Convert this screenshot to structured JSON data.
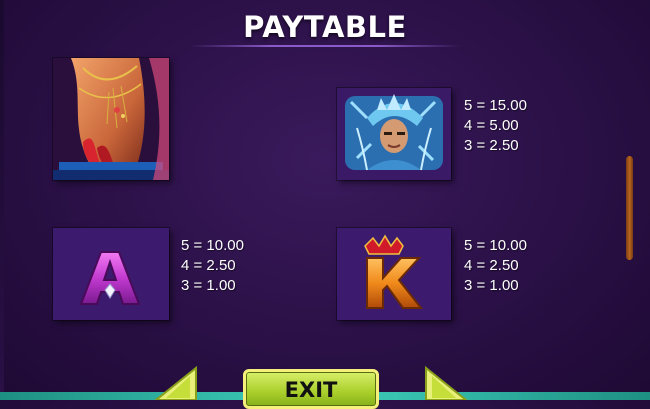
{
  "title": "PAYTABLE",
  "symbols": [
    {
      "name": "dancer",
      "pays": []
    },
    {
      "name": "carnival-king",
      "pays": [
        "5 = 15.00",
        "4 = 5.00",
        "3 = 2.50"
      ]
    },
    {
      "name": "ace",
      "letter": "A",
      "pays": [
        "5 = 10.00",
        "4 = 2.50",
        "3 = 1.00"
      ]
    },
    {
      "name": "king",
      "letter": "K",
      "pays": [
        "5 = 10.00",
        "4 = 2.50",
        "3 = 1.00"
      ]
    }
  ],
  "nav": {
    "exit_label": "EXIT",
    "prev_icon": "arrow-left-icon",
    "next_icon": "arrow-right-icon"
  },
  "colors": {
    "background": "#2a1046",
    "exit_button": "#a9cf2a",
    "scrollbar": "#b8661e",
    "bottom_bar": "#3fd0bd"
  }
}
